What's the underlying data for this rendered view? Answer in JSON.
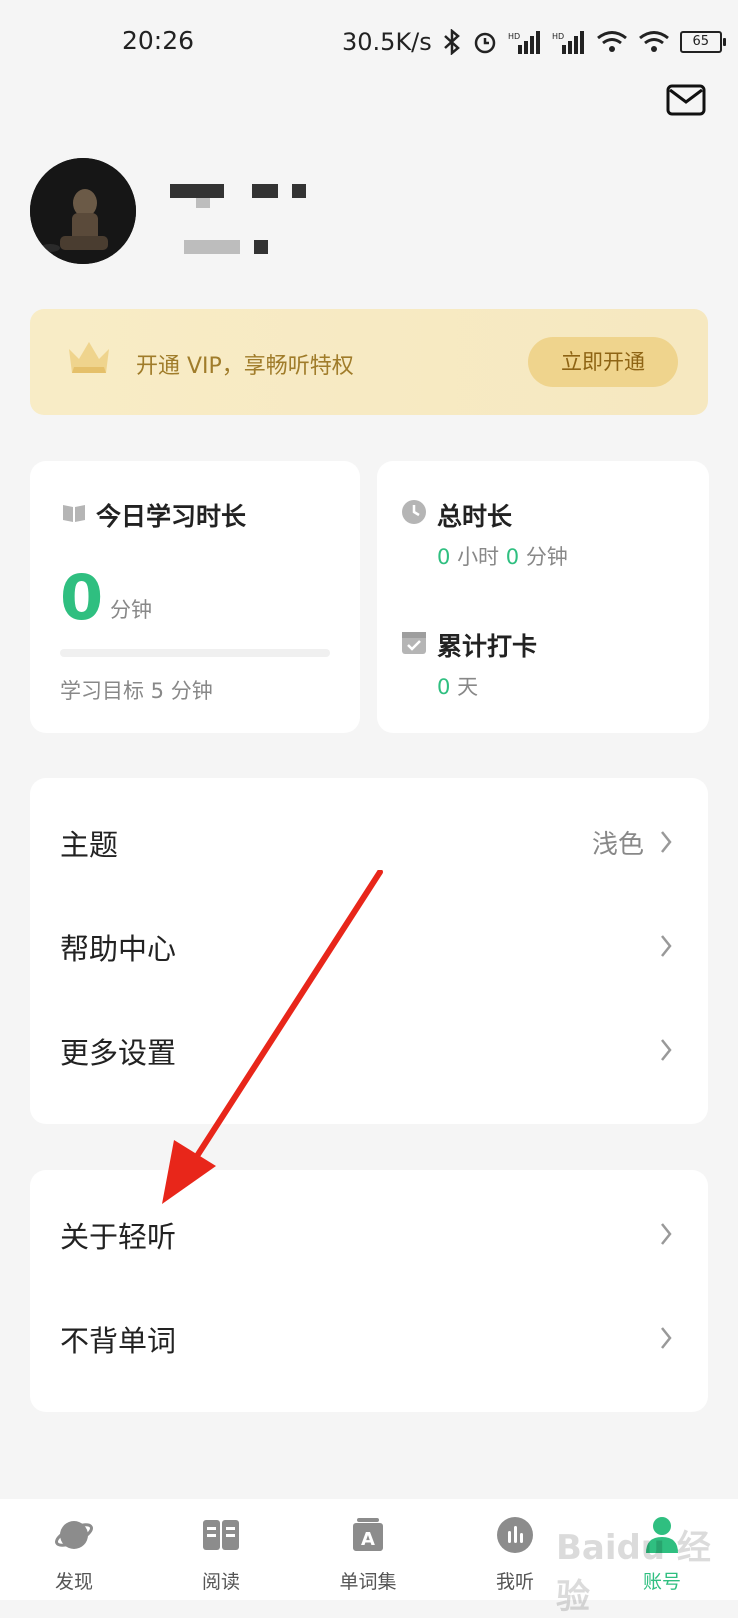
{
  "status_bar": {
    "time": "20:26",
    "net_speed": "30.5K/s",
    "battery": "65"
  },
  "header": {
    "mail_icon": "mail-icon"
  },
  "vip": {
    "text": "开通 VIP，享畅听特权",
    "button": "立即开通"
  },
  "stats": {
    "today_title": "今日学习时长",
    "today_value": "0",
    "today_unit": "分钟",
    "today_progress": 0,
    "goal_text": "学习目标 5 分钟",
    "total_title": "总时长",
    "total_hours": "0",
    "hours_unit": "小时",
    "total_minutes": "0",
    "minutes_unit": "分钟",
    "checkin_title": "累计打卡",
    "checkin_days": "0",
    "days_unit": "天"
  },
  "menu": [
    {
      "label": "主题",
      "value": "浅色"
    },
    {
      "label": "帮助中心"
    },
    {
      "label": "更多设置"
    }
  ],
  "menu2": [
    {
      "label": "关于轻听"
    },
    {
      "label": "不背单词"
    }
  ],
  "tabs": [
    {
      "label": "发现",
      "icon": "planet-icon"
    },
    {
      "label": "阅读",
      "icon": "book-icon"
    },
    {
      "label": "单词集",
      "icon": "word-book-icon"
    },
    {
      "label": "我听",
      "icon": "audio-bars-icon"
    },
    {
      "label": "账号",
      "icon": "account-icon",
      "active": true
    }
  ],
  "colors": {
    "accent": "#2fbf80",
    "vip_bg": "#f8ecc6",
    "vip_button": "#efd48d",
    "arrow": "#e8261a"
  }
}
